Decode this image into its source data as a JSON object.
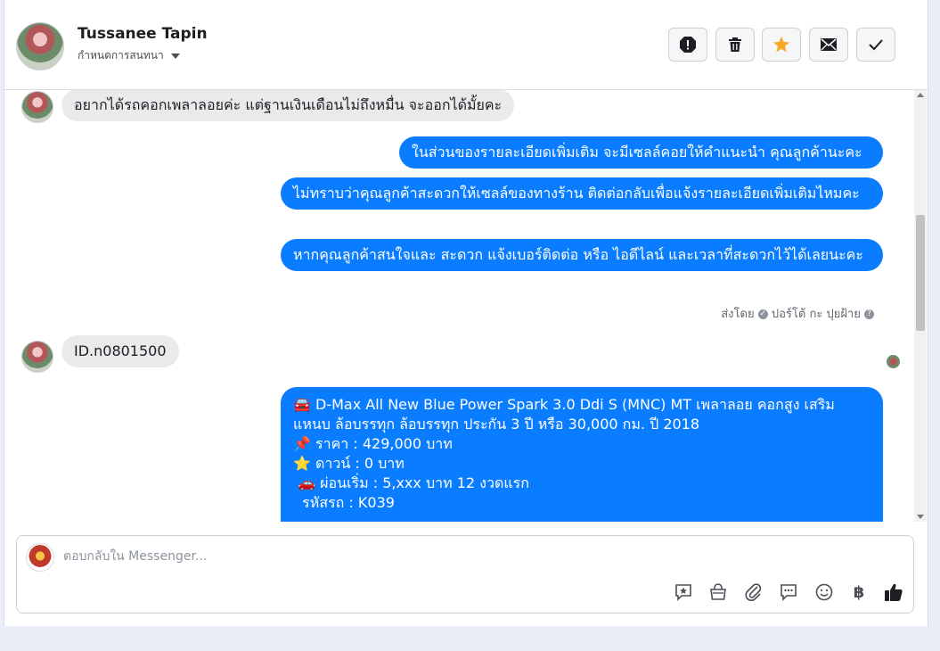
{
  "header": {
    "contact_name": "Tussanee Tapin",
    "assign_label": "กำหนดการสนทนา",
    "actions": [
      {
        "name": "spam-icon"
      },
      {
        "name": "trash-icon"
      },
      {
        "name": "star-icon",
        "color": "#f7a825"
      },
      {
        "name": "mail-icon"
      },
      {
        "name": "check-icon"
      }
    ]
  },
  "messages": {
    "in_1": "อยากได้รถคอกเพลาลอยค่ะ  แต่ฐานเงินเดือนไม่ถึงหมื่น จะออกได้มั้ยคะ",
    "out_1": "ในส่วนของรายละเอียดเพิ่มเติม จะมีเซลล์คอยให้คำแนะนำ คุณลูกค้านะคะ",
    "out_2": "ไม่ทราบว่าคุณลูกค้าสะดวกให้เซลล์ของทางร้าน ติดต่อกลับเพื่อแจ้งรายละเอียดเพิ่มเติมไหมคะ",
    "out_3": "หากคุณลูกค้าสนใจและ สะดวก แจ้งเบอร์ติดต่อ หรือ ไอดีไลน์ และเวลาที่สะดวกไว้ได้เลยนะคะ",
    "sent_by_prefix": "ส่งโดย",
    "sent_by_name": "ปอร์โต้ กะ ปุยฝ้าย",
    "in_2": "ID.n0801500",
    "out_4_lines": [
      "🚘 D-Max All New Blue Power Spark 3.0 Ddi S (MNC) MT เพลาลอย คอกสูง เสริมแหนบ ล้อบรรทุก ล้อบรรทุก ประกัน 3 ปี หรือ 30,000 กม. ปี 2018",
      "📌 ราคา : 429,000 บาท",
      "⭐ ดาวน์ : 0 บาท",
      " 🚗 ผ่อนเริ่ม : 5,xxx บาท 12 งวดแรก",
      "  รหัสรถ : K039"
    ]
  },
  "composer": {
    "placeholder": "ตอบกลับใน Messenger...",
    "tools": [
      "saved-reply-icon",
      "shop-icon",
      "attach-icon",
      "quick-reply-icon",
      "emoji-icon",
      "baht-icon",
      "like-icon"
    ],
    "baht_symbol": "฿"
  },
  "colors": {
    "outgoing_bubble": "#0a7cff",
    "incoming_bubble": "#e9eaec",
    "star": "#f7a825"
  }
}
